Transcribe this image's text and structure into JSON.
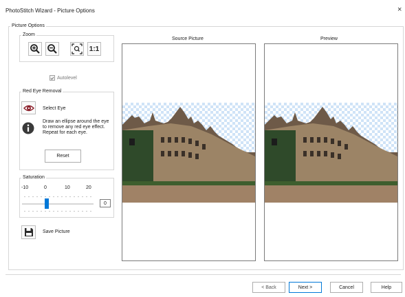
{
  "window": {
    "title": "PhotoStitch Wizard - Picture Options",
    "close": "×"
  },
  "picture_options": {
    "label": "Picture Options"
  },
  "zoom": {
    "label": "Zoom",
    "actual_size": "1:1"
  },
  "autolevel": {
    "label": "Autolevel",
    "checked": true
  },
  "red_eye": {
    "label": "Red Eye Removal",
    "select_eye": "Select Eye",
    "description": "Draw an ellipse around the eye to remove any red eye effect. Repeat for each eye.",
    "reset": "Reset"
  },
  "saturation": {
    "label": "Saturation",
    "scale": [
      "-10",
      "0",
      "10",
      "20"
    ],
    "min": -10,
    "max": 20,
    "value": 0,
    "value_text": "0"
  },
  "save_picture": {
    "label": "Save Picture"
  },
  "source": {
    "label": "Source Picture"
  },
  "preview": {
    "label": "Preview"
  },
  "footer": {
    "back": "< Back",
    "next": "Next >",
    "cancel": "Cancel",
    "help": "Help"
  },
  "colors": {
    "accent": "#0078d7",
    "red_eye": "#8b1f2a"
  }
}
